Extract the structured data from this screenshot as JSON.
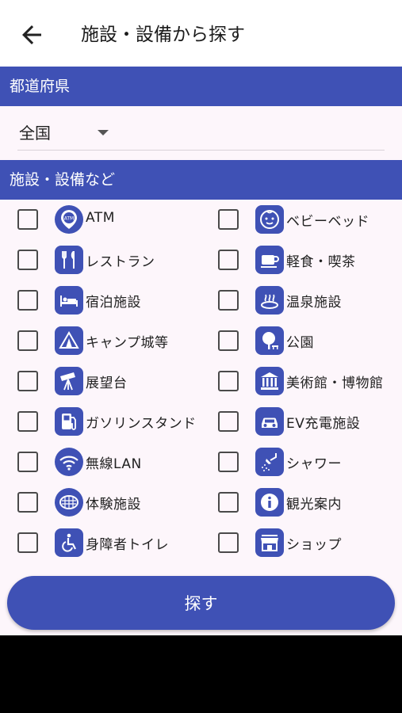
{
  "appbar": {
    "title": "施設・設備から探す"
  },
  "prefecture": {
    "header": "都道府県",
    "selected": "全国"
  },
  "facilities": {
    "header": "施設・設備など",
    "items": [
      {
        "label": "ATM",
        "icon": "atm-icon"
      },
      {
        "label": "ベビーベッド",
        "icon": "baby-icon"
      },
      {
        "label": "レストラン",
        "icon": "restaurant-icon"
      },
      {
        "label": "軽食・喫茶",
        "icon": "cafe-icon"
      },
      {
        "label": "宿泊施設",
        "icon": "bed-icon"
      },
      {
        "label": "温泉施設",
        "icon": "hot-spring-icon"
      },
      {
        "label": "キャンプ城等",
        "icon": "camp-tent-icon"
      },
      {
        "label": "公園",
        "icon": "park-tree-icon"
      },
      {
        "label": "展望台",
        "icon": "telescope-icon"
      },
      {
        "label": "美術館・博物館",
        "icon": "museum-icon"
      },
      {
        "label": "ガソリンスタンド",
        "icon": "gas-station-icon"
      },
      {
        "label": "EV充電施設",
        "icon": "ev-car-icon"
      },
      {
        "label": "無線LAN",
        "icon": "wifi-icon"
      },
      {
        "label": "シャワー",
        "icon": "shower-icon"
      },
      {
        "label": "体験施設",
        "icon": "experience-icon"
      },
      {
        "label": "観光案内",
        "icon": "info-icon"
      },
      {
        "label": "身障者トイレ",
        "icon": "wheelchair-icon"
      },
      {
        "label": "ショップ",
        "icon": "shop-icon"
      }
    ]
  },
  "search_button": {
    "label": "探す"
  },
  "colors": {
    "accent": "#3f51b5",
    "background": "#fdf6fb"
  }
}
